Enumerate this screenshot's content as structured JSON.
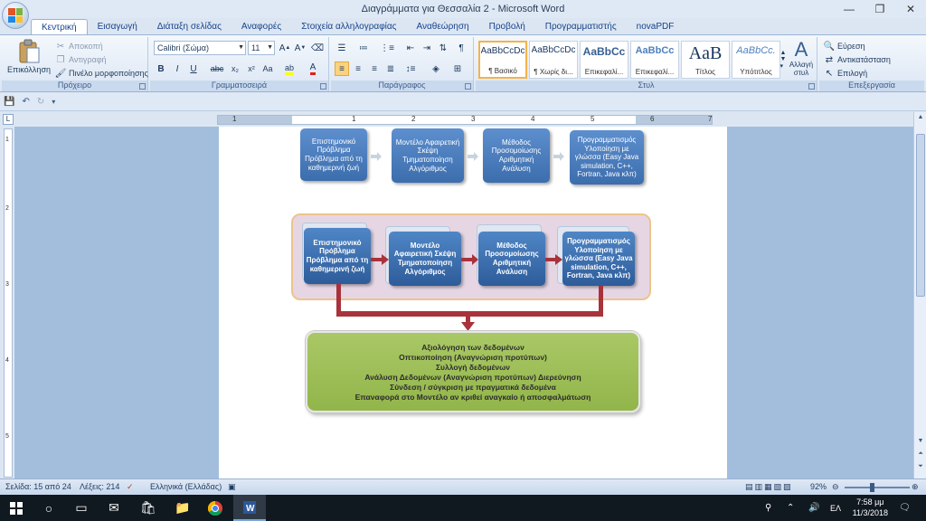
{
  "window": {
    "title": "Διαγράμματα για Θεσσαλία 2 - Microsoft Word",
    "controls": {
      "minimize": "—",
      "maximize": "❐",
      "close": "✕"
    }
  },
  "tabs": [
    {
      "label": "Κεντρική",
      "active": true
    },
    {
      "label": "Εισαγωγή"
    },
    {
      "label": "Διάταξη σελίδας"
    },
    {
      "label": "Αναφορές"
    },
    {
      "label": "Στοιχεία αλληλογραφίας"
    },
    {
      "label": "Αναθεώρηση"
    },
    {
      "label": "Προβολή"
    },
    {
      "label": "Προγραμματιστής"
    },
    {
      "label": "novaPDF"
    }
  ],
  "ribbon": {
    "clipboard": {
      "group_label": "Πρόχειρο",
      "paste": "Επικόλληση",
      "cut": "Αποκοπή",
      "copy": "Αντιγραφή",
      "format_painter": "Πινέλο μορφοποίησης"
    },
    "font": {
      "group_label": "Γραμματοσειρά",
      "font_name": "Calibri (Σώμα)",
      "font_size": "11",
      "buttons": [
        "B",
        "I",
        "U",
        "abc",
        "x₂",
        "x²",
        "Aa"
      ]
    },
    "paragraph": {
      "group_label": "Παράγραφος"
    },
    "styles": {
      "group_label": "Στυλ",
      "tiles": [
        {
          "sample": "AaBbCcDc",
          "name": "¶ Βασικό",
          "selected": true
        },
        {
          "sample": "AaBbCcDc",
          "name": "¶ Χωρίς δι..."
        },
        {
          "sample": "AaBbCc",
          "name": "Επικεφαλί..."
        },
        {
          "sample": "AaBbCc",
          "name": "Επικεφαλί..."
        },
        {
          "sample": "AaB",
          "name": "Τίτλος"
        },
        {
          "sample": "AaBbCc.",
          "name": "Υπότιτλος"
        }
      ],
      "change_styles": "Αλλαγή στυλ"
    },
    "editing": {
      "group_label": "Επεξεργασία",
      "find": "Εύρεση",
      "replace": "Αντικατάσταση",
      "select": "Επιλογή"
    }
  },
  "ruler_numbers": [
    "1",
    "1",
    "2",
    "3",
    "4",
    "5",
    "6",
    "7"
  ],
  "vruler_numbers": [
    "1",
    "2",
    "3",
    "4",
    "5"
  ],
  "diagram_top": {
    "boxes": [
      "Επιστημονικό Πρόβλημα Πρόβλημα από τη καθημερινή ζωή",
      "Μοντέλο Αφαιρετική Σκέψη Τμηματοποίηση Αλγόριθμος",
      "Μέθοδος Προσομοίωσης Αριθμητική Ανάλυση",
      "Προγραμματισμός Υλοποίηση με γλώσσα (Easy Java simulation, C++, Fortran, Java κλπ)"
    ]
  },
  "diagram_main": {
    "boxes": [
      "Επιστημονικό Πρόβλημα Πρόβλημα από τη καθημερινή ζωή",
      "Μοντέλο Αφαιρετική Σκέψη Τμηματοποίηση Αλγόριθμος",
      "Μέθοδος Προσομοίωσης Αριθμητική Ανάλυση",
      "Προγραμματισμός Υλοποίηση με γλώσσα (Easy Java simulation, C++, Fortran, Java κλπ)"
    ],
    "green_lines": [
      "Αξιολόγηση των δεδομένων",
      "Οπτικοποίηση (Αναγνώριση προτύπων)",
      "Συλλογή δεδομένων",
      "Ανάλυση Δεδομένων (Αναγνώριση προτύπων) Διερεύνηση",
      "Σύνδεση / σύγκριση με πραγματικά δεδομένα",
      "Επαναφορά στο Μοντέλο αν κριθεί αναγκαίο ή αποσφαλμάτωση"
    ]
  },
  "statusbar": {
    "page": "Σελίδα: 15 από 24",
    "words": "Λέξεις: 214",
    "language": "Ελληνικά (Ελλάδας)",
    "zoom": "92%"
  },
  "taskbar": {
    "lang": "ΕΛ",
    "time": "7:58 μμ",
    "date": "11/3/2018"
  },
  "colors": {
    "box_blue": "#3c6dad",
    "arrow_red": "#a8333a",
    "panel_pink": "#e6d6e4",
    "green_box": "#9bbb59"
  }
}
